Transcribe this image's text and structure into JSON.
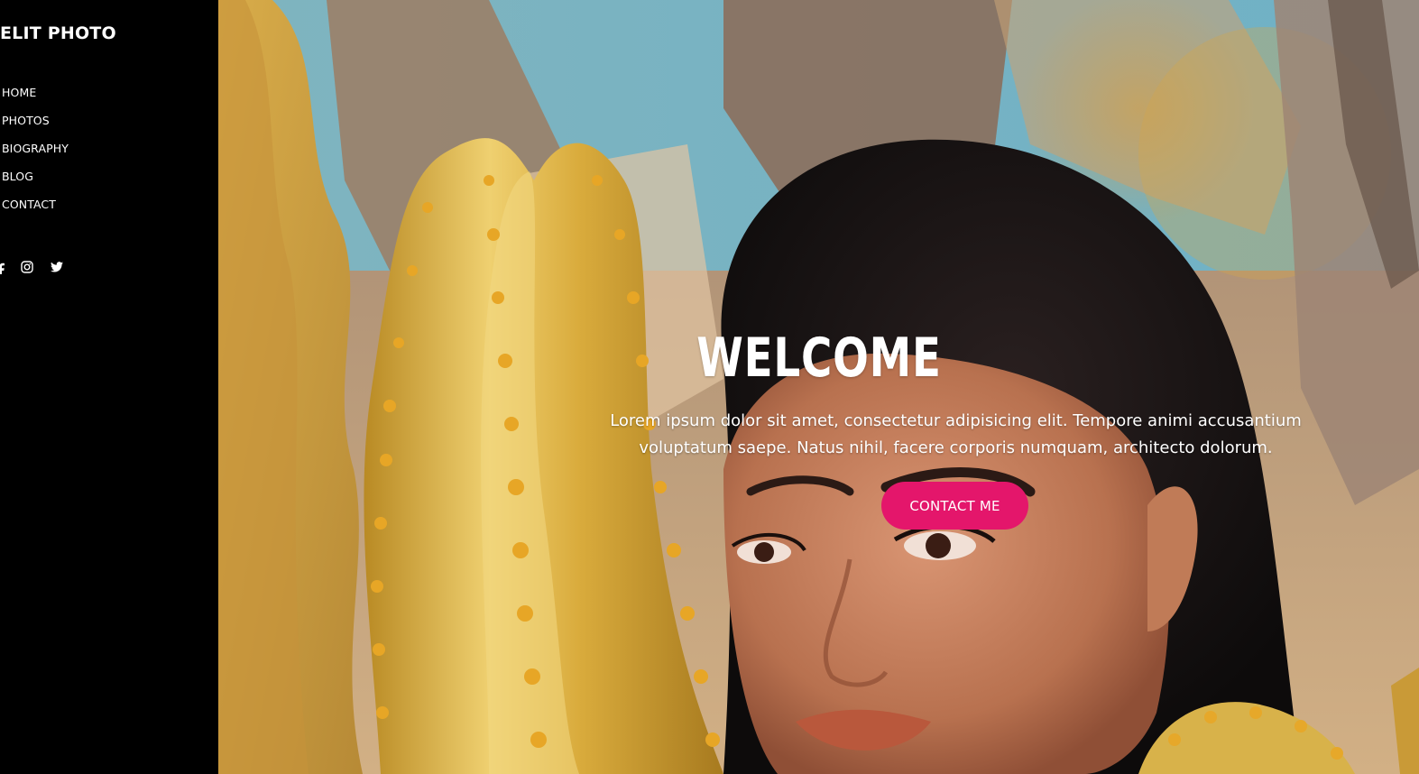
{
  "brand": {
    "name": "ELIT PHOTO"
  },
  "nav": {
    "items": [
      {
        "label": "HOME"
      },
      {
        "label": "PHOTOS"
      },
      {
        "label": "BIOGRAPHY"
      },
      {
        "label": "BLOG"
      },
      {
        "label": "CONTACT"
      }
    ]
  },
  "social": {
    "icons": [
      "facebook-icon",
      "instagram-icon",
      "twitter-icon"
    ]
  },
  "hero": {
    "title": "WELCOME",
    "text": "Lorem ipsum dolor sit amet, consectetur adipisicing elit. Tempore animi accusantium voluptatum saepe. Natus nihil, facere corporis numquam, architecto dolorum.",
    "cta_label": "CONTACT ME"
  },
  "colors": {
    "sidebar_bg": "#000000",
    "accent": "#e4166b",
    "text": "#ffffff"
  }
}
